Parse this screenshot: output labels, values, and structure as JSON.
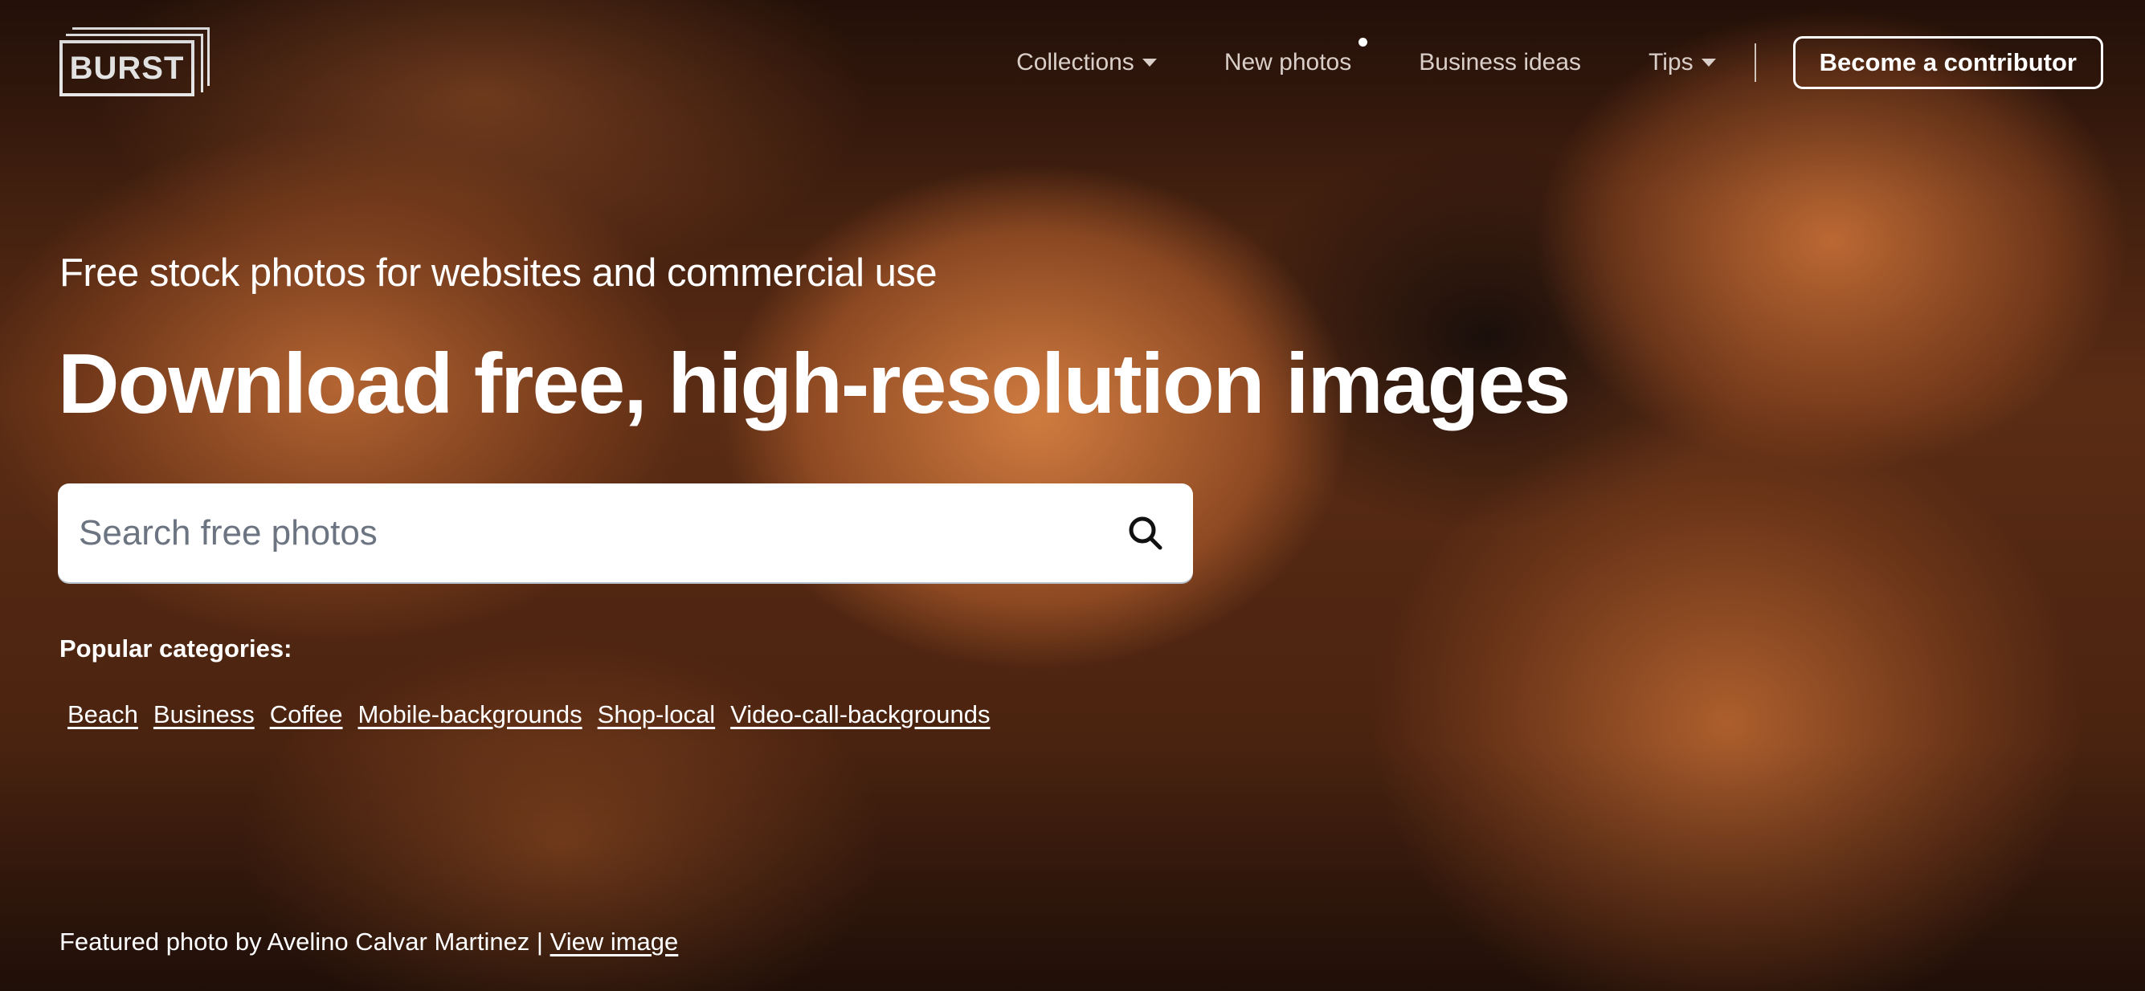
{
  "logo": {
    "text": "BURST"
  },
  "nav": {
    "items": [
      {
        "label": "Collections",
        "has_dropdown": true
      },
      {
        "label": "New photos",
        "has_dot": true
      },
      {
        "label": "Business ideas"
      },
      {
        "label": "Tips",
        "has_dropdown": true
      }
    ],
    "cta_label": "Become a contributor"
  },
  "hero": {
    "subtitle": "Free stock photos for websites and commercial use",
    "headline": "Download free, high-resolution images"
  },
  "search": {
    "placeholder": "Search free photos",
    "value": "",
    "icon": "search-icon"
  },
  "categories": {
    "label": "Popular categories:",
    "items": [
      "Beach",
      "Business",
      "Coffee",
      "Mobile-backgrounds",
      "Shop-local",
      "Video-call-backgrounds"
    ]
  },
  "credit": {
    "text": "Featured photo by Avelino Calvar Martinez | ",
    "link_label": "View image"
  },
  "colors": {
    "text": "#ffffff",
    "nav_text": "#d9cfc8",
    "placeholder": "#6b7480",
    "search_bg": "#ffffff"
  }
}
